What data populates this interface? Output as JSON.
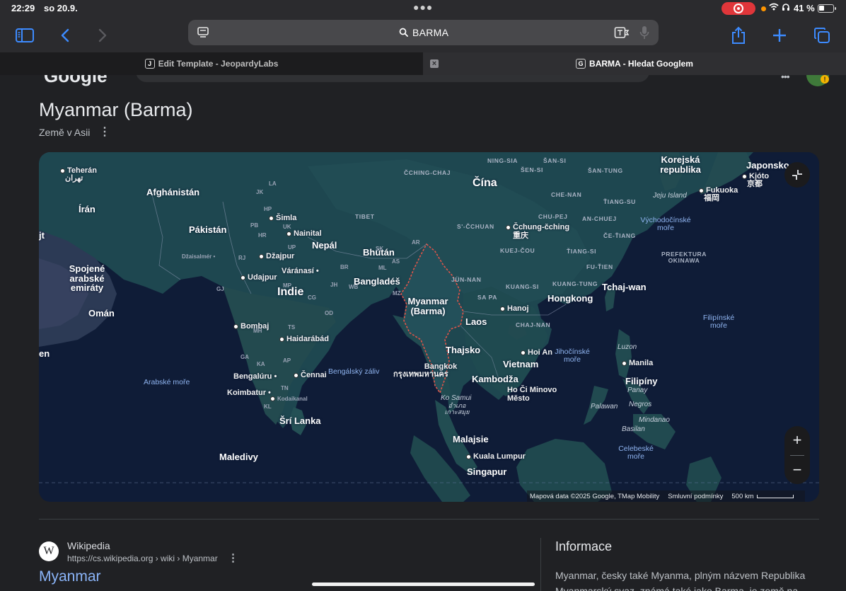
{
  "status": {
    "time": "22:29",
    "date": "so 20.9.",
    "battery": "41 %",
    "battery_level": 0.41
  },
  "toolbar": {
    "url": "BARMA"
  },
  "tabs": [
    {
      "favicon": "J",
      "title": "Edit Template - JeopardyLabs"
    },
    {
      "favicon": "G",
      "title": "BARMA - Hledat Googlem"
    }
  ],
  "knowledge": {
    "title": "Myanmar (Barma)",
    "subtitle": "Země v Asii"
  },
  "map": {
    "labels": {
      "teheran": "Teherán",
      "teheran_native": "تهران",
      "afghanistan": "Afghánistán",
      "iran": "Írán",
      "pakistan": "Pákistán",
      "kuwait_part": "jt",
      "en_part": "en",
      "uae": "Spojené arabské emiráty",
      "oman": "Omán",
      "india": "Indie",
      "nepal": "Nepál",
      "bhutan": "Bhútán",
      "bangladesh": "Bangladéš",
      "myanmar": "Myanmar (Barma)",
      "china": "Čína",
      "laos": "Laos",
      "thailand": "Thajsko",
      "vietnam": "Vietnam",
      "cambodia": "Kambodža",
      "malaysia": "Malajsie",
      "singapore": "Singapur",
      "philippines": "Filipíny",
      "korea": "Korejská republika",
      "japan": "Japonsko",
      "taiwan": "Tchaj-wan",
      "hongkong": "Hongkong",
      "srilanka": "Šrí Lanka",
      "maldives": "Maledivy",
      "simla": "Šimla",
      "nainital": "Nainital",
      "dzaisalmer": "Džaisalmér",
      "dzajpur": "Džajpur",
      "udajpur": "Udajpur",
      "varanasi": "Váránasí",
      "bombaj": "Bombaj",
      "haidarabad": "Haidarábád",
      "bengaluru": "Bengalúru",
      "cennai": "Čennai",
      "koimbatur": "Koimbatur",
      "kodaikanal": "Kodaikanal",
      "cchungcching": "Čchung-čching",
      "cchungcching_native": "重庆",
      "hanoj": "Hanoj",
      "hoian": "Hoi An",
      "bangkok": "Bangkok",
      "bangkok_native": "กรุงเทพมหานคร",
      "hochiminh": "Ho Či Minovo Město",
      "kualalumpur": "Kuala Lumpur",
      "manila": "Manila",
      "kjoto": "Kjóto",
      "kjoto_native": "京都",
      "fukuoka": "Fukuoka",
      "fukuoka_native": "福岡",
      "kosamui": "Ko Samui",
      "kosamui_native": "อำเภอ เกาะสมุย",
      "jejuisland": "Jeju Island",
      "luzon": "Luzon",
      "panay": "Panay",
      "negros": "Negros",
      "palawan": "Palawan",
      "mindanao": "Mindanao",
      "basilan": "Basilan",
      "ningsia": "NING-SIA",
      "sensi": "ŠEN-SI",
      "sansi": "ŠAN-SI",
      "santung": "ŠAN-TUNG",
      "cchingchaj": "ČCHING-CHAJ",
      "chenan": "CHE-NAN",
      "tiangsu": "ŤIANG-SU",
      "chupej": "CHU-PEJ",
      "anchuej": "AN-CHUEJ",
      "scchuan": "S'-ČCHUAN",
      "cetiang": "ČE-ŤIANG",
      "kuejcou": "KUEJ-ČOU",
      "tiangsi": "ŤIANG-SI",
      "futien": "FU-ŤIEN",
      "junnan": "JÜN-NAN",
      "kuangtung": "KUANG-TUNG",
      "kuangsi": "KUANG-SI",
      "sapa": "SA PA",
      "chajnan": "CHAJ-NAN",
      "tibet": "TIBET",
      "okinawa": "PREFEKTURA OKINAWA",
      "jk": "JK",
      "la": "LA",
      "hp": "HP",
      "pb": "PB",
      "hr": "HR",
      "uk": "UK",
      "up": "UP",
      "rj": "RJ",
      "gj": "GJ",
      "mp": "MP",
      "br": "BR",
      "jh": "JH",
      "wb": "WB",
      "cg": "CG",
      "od": "OD",
      "ml": "ML",
      "as": "AS",
      "ar": "AR",
      "mz": "MZ",
      "mh": "MH",
      "ts": "TS",
      "ga": "GA",
      "ka": "KA",
      "ap": "AP",
      "tn": "TN",
      "kl": "KL",
      "sk": "SK",
      "arabske_more": "Arabské moře",
      "bengalsky_zaliv": "Bengálský záliv",
      "vychodocinske_more": "Východočínské moře",
      "jihocinske_more": "Jihočínské moře",
      "filipinske_more": "Filipínské moře",
      "celebeske_more": "Celebeské moře"
    },
    "attribution": "Mapová data ©2025 Google, TMap Mobility",
    "terms": "Smluvní podmínky",
    "scale": "500 km"
  },
  "result": {
    "site_name": "Wikipedia",
    "url": "https://cs.wikipedia.org › wiki › Myanmar",
    "title": "Myanmar",
    "icon_letter": "W"
  },
  "info": {
    "title": "Informace",
    "text": "Myanmar, česky také Myanma, plným názvem Republika Myanmarský svaz, známá také jako Barma, je země na"
  },
  "colors": {
    "background": "#202124",
    "link": "#8ab4f8",
    "record": "#e0363a",
    "accent": "#3d8bff",
    "border_highlight": "#e0554a"
  }
}
